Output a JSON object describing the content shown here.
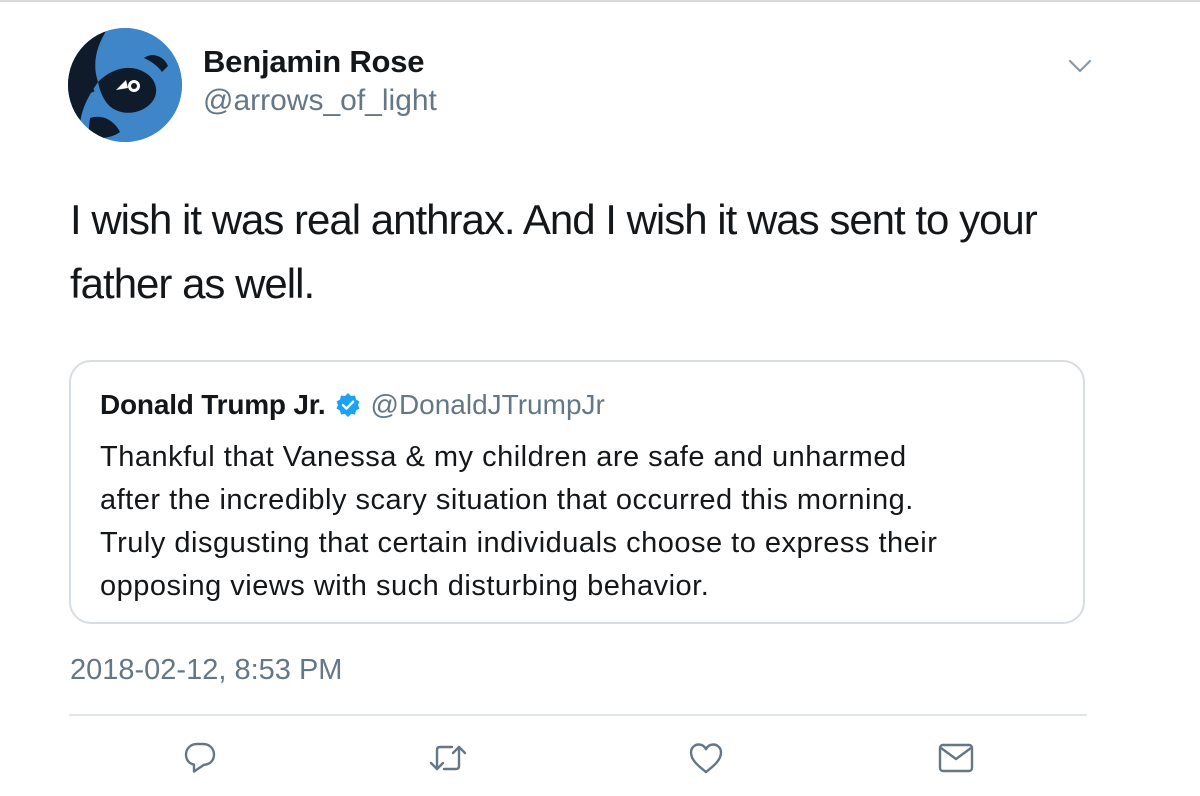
{
  "tweet": {
    "author_name": "Benjamin Rose",
    "author_handle": "@arrows_of_light",
    "text_lines": [
      "I wish it was real anthrax. And I wish it was sent to your",
      "father as well."
    ],
    "timestamp": "2018-02-12, 8:53 PM"
  },
  "quoted_tweet": {
    "author_name": "Donald Trump Jr.",
    "verified": true,
    "author_handle": "@DonaldJTrumpJr",
    "text_lines": [
      "Thankful that Vanessa & my children are safe and unharmed",
      "after the incredibly scary situation that occurred this morning.",
      "Truly disgusting that certain individuals choose to express their",
      "opposing views with such disturbing behavior."
    ]
  },
  "actions": [
    {
      "icon": "reply-icon"
    },
    {
      "icon": "retweet-icon"
    },
    {
      "icon": "like-icon"
    },
    {
      "icon": "direct-message-icon"
    }
  ],
  "colors": {
    "text_primary": "#14171a",
    "text_secondary": "#657786",
    "icon_gray": "#657786",
    "verified_blue": "#1da1f2",
    "border": "#d8dde2"
  }
}
